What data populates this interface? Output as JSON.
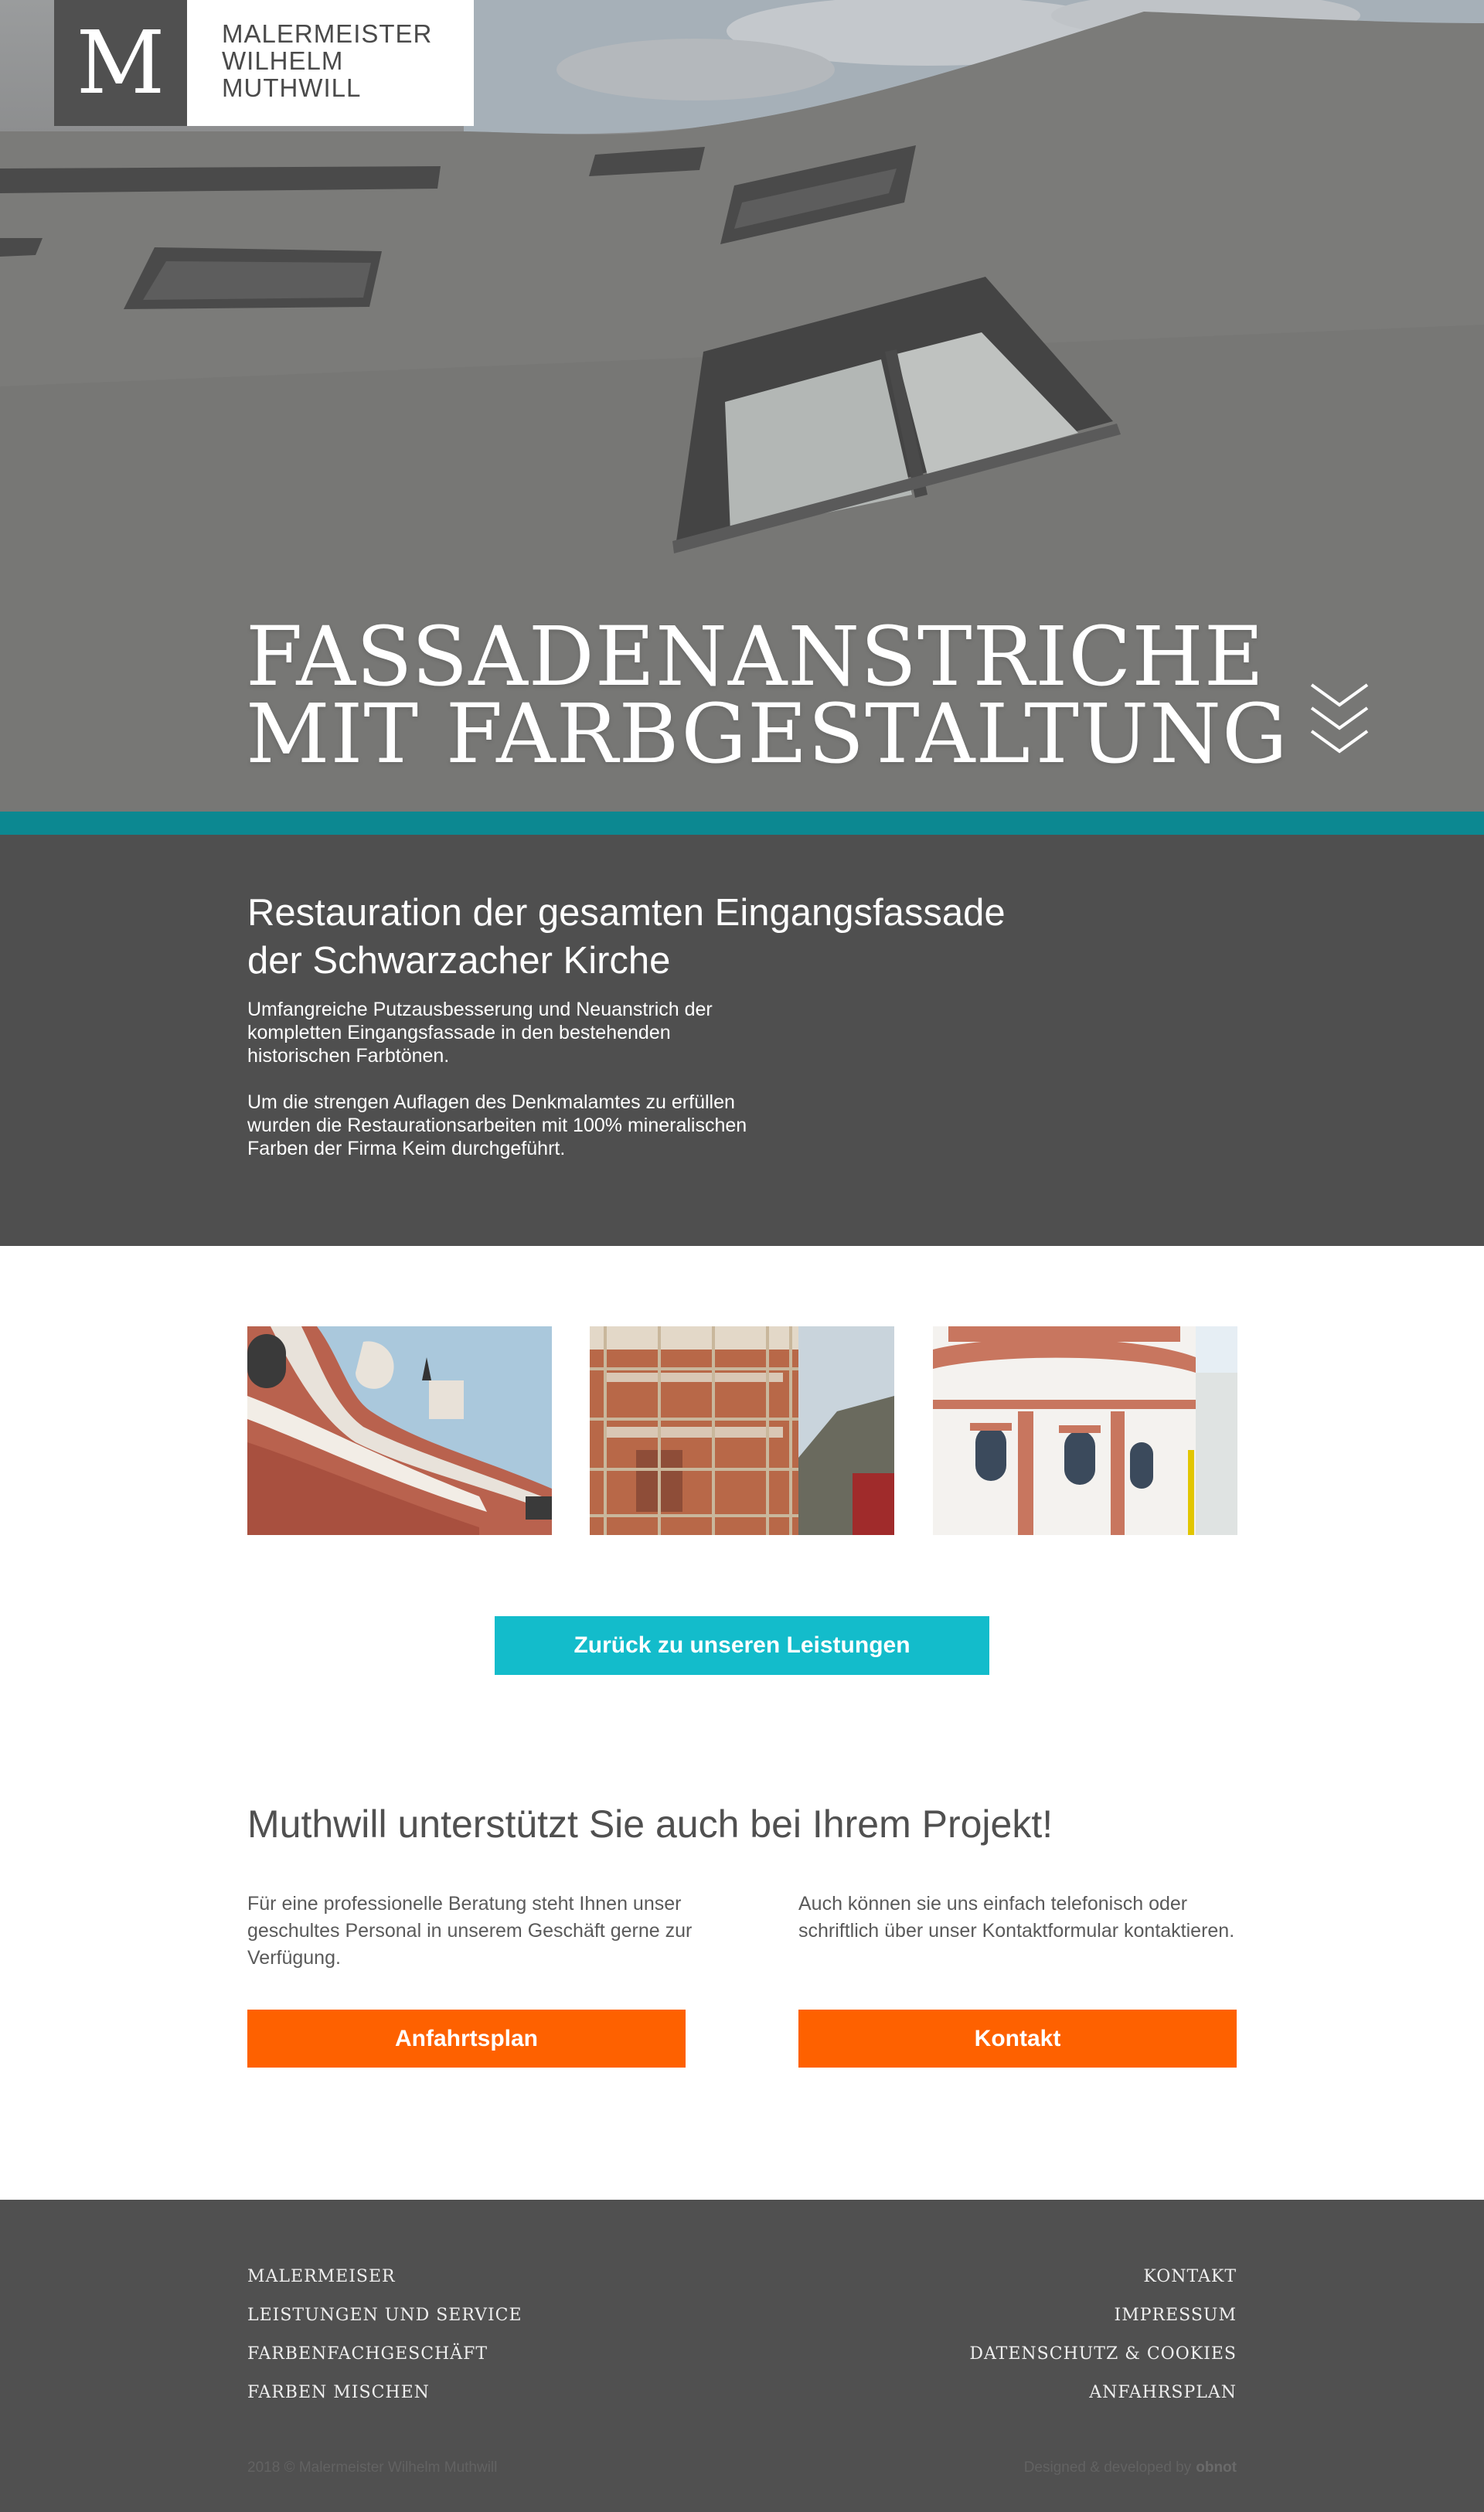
{
  "logo": {
    "mark": "M",
    "lines": [
      "MALERMEISTER",
      "WILHELM",
      "MUTHWILL"
    ]
  },
  "hero": {
    "title_lines": [
      "FASSADENANSTRICHE",
      "MIT  FARBGESTALTUNG"
    ],
    "scroll_icon": "double-chevron-down-icon"
  },
  "intro": {
    "heading_lines": [
      "Restauration der gesamten Eingangsfassade",
      "der Schwarzacher Kirche"
    ],
    "paragraph1": "Umfangreiche Putzausbesserung und Neuanstrich der kompletten Eingangsfassade in den bestehenden historischen Farbtönen.",
    "paragraph2": "Um die strengen Auflagen des Denkmalamtes zu erfüllen wurden die Restaurationsarbeiten mit 100% mineralischen Farben der Firma Keim durchgeführt."
  },
  "gallery": {
    "back_button": "Zurück zu unseren Leistungen"
  },
  "cta": {
    "title": "Muthwill unterstützt Sie auch bei Ihrem Projekt!",
    "left_text": "Für eine professionelle Beratung steht Ihnen unser geschultes Personal in unserem Geschäft gerne zur Verfügung.",
    "right_text": "Auch können sie uns einfach telefonisch oder schriftlich über unser Kontaktformular kontaktieren.",
    "map_button": "Anfahrtsplan",
    "contact_button": "Kontakt"
  },
  "footer": {
    "left_links": [
      "MALERMEISER",
      "LEISTUNGEN UND SERVICE",
      "FARBENFACHGESCHÄFT",
      "FARBEN MISCHEN"
    ],
    "right_links": [
      "KONTAKT",
      "IMPRESSUM",
      "DATENSCHUTZ & COOKIES",
      "ANFAHRSPLAN"
    ],
    "copyright": "2018 © Malermeister Wilhelm Muthwill",
    "credit": "Designed & developed by",
    "credit_brand": "obnot"
  },
  "colors": {
    "teal_strip": "#0c8891",
    "dark_gray": "#4f4f4f",
    "cyan_button": "#13bccb",
    "orange_button": "#fe6100"
  }
}
